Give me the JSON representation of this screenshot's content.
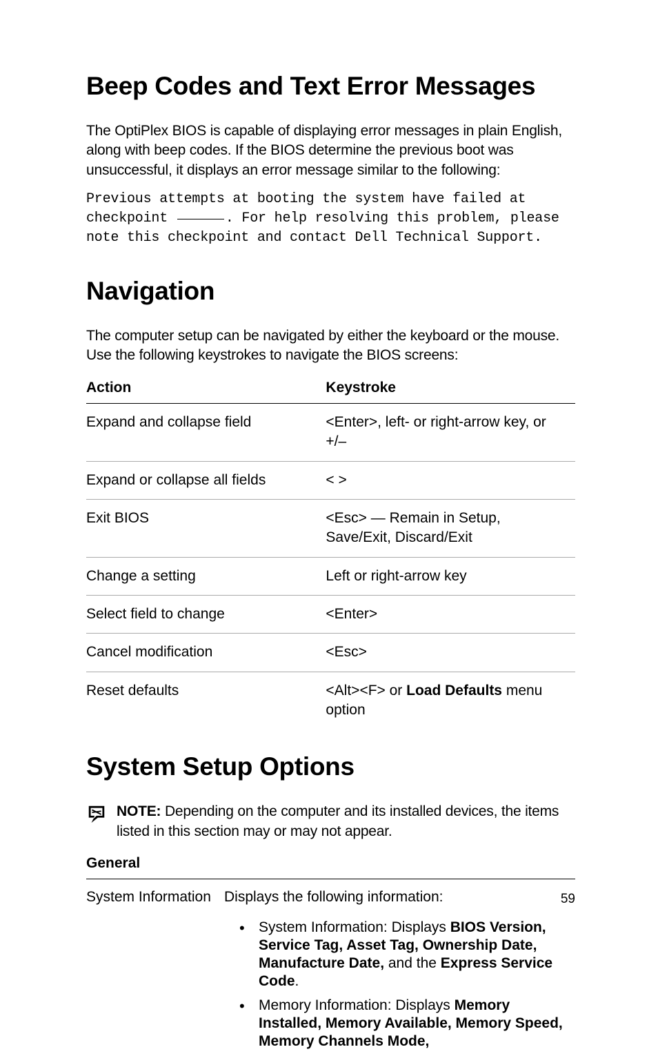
{
  "sec1": {
    "title": "Beep Codes and Text Error Messages",
    "intro": "The OptiPlex BIOS is capable of displaying error messages in plain English, along with beep codes. If the BIOS determine the previous boot was unsuccessful, it displays an error message similar to the following:",
    "code_pre": "Previous attempts at booting the system have failed at checkpoint ",
    "code_post": ". For help resolving this problem, please note this checkpoint and contact Dell Technical Support."
  },
  "sec2": {
    "title": "Navigation",
    "intro": "The computer setup can be navigated by either the keyboard or the mouse. Use the following keystrokes to navigate the BIOS screens:",
    "th_action": "Action",
    "th_key": "Keystroke",
    "rows": [
      {
        "action": "Expand and collapse field",
        "key": "<Enter>, left- or right-arrow key, or +/–"
      },
      {
        "action": "Expand or collapse all fields",
        "key": "< >"
      },
      {
        "action": "Exit BIOS",
        "key": "<Esc> — Remain in Setup, Save/Exit, Discard/Exit"
      },
      {
        "action": "Change a setting",
        "key": "Left or right-arrow key"
      },
      {
        "action": "Select field to change",
        "key": "<Enter>"
      },
      {
        "action": "Cancel modification",
        "key": "<Esc>"
      },
      {
        "action": "Reset defaults",
        "key_pre": "<Alt><F> or ",
        "key_bold": "Load Defaults",
        "key_post": " menu option"
      }
    ]
  },
  "sec3": {
    "title": "System Setup Options",
    "note_label": "NOTE:",
    "note_body": " Depending on the computer and its installed devices, the items listed in this section may or may not appear.",
    "table_header": "General",
    "row_label": "System Information",
    "row_intro": "Displays the following information:",
    "bullet1_pre": "System Information: Displays ",
    "bullet1_bold1": "BIOS Version, Service Tag, Asset Tag, Ownership Date, Manufacture Date,",
    "bullet1_mid": " and the ",
    "bullet1_bold2": "Express Service Code",
    "bullet1_post": ".",
    "bullet2_pre": "Memory Information: Displays ",
    "bullet2_bold": "Memory Installed, Memory Available, Memory Speed, Memory Channels Mode,"
  },
  "page_number": "59"
}
